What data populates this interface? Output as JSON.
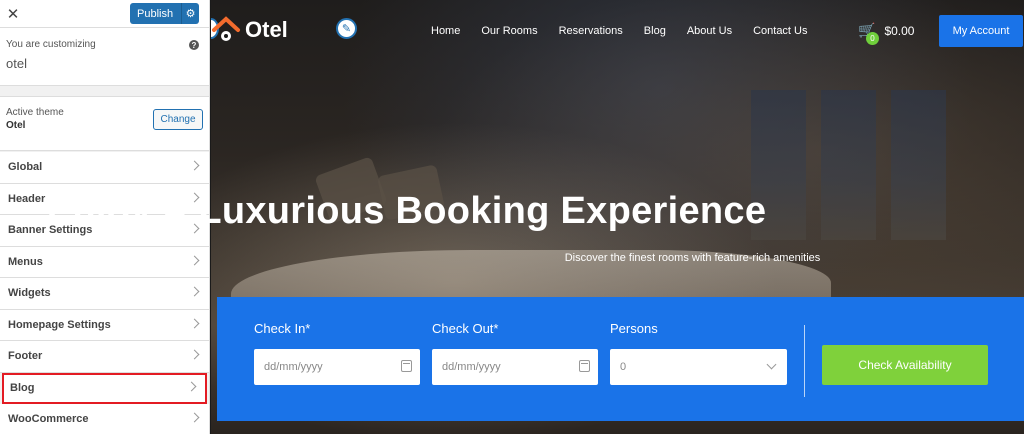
{
  "sidebar": {
    "publish_label": "Publish",
    "customizing_label": "You are customizing",
    "site_name": "otel",
    "active_theme_label": "Active theme",
    "theme_name": "Otel",
    "change_label": "Change",
    "menu": [
      {
        "label": "Global"
      },
      {
        "label": "Header"
      },
      {
        "label": "Banner Settings"
      },
      {
        "label": "Menus"
      },
      {
        "label": "Widgets"
      },
      {
        "label": "Homepage Settings"
      },
      {
        "label": "Footer"
      },
      {
        "label": "Blog"
      },
      {
        "label": "WooCommerce"
      }
    ],
    "highlighted_item": "Blog",
    "highlight_color": "#e31b23",
    "accent_color": "#2271b1"
  },
  "site": {
    "logo_text": "Otel",
    "nav": [
      "Home",
      "Our Rooms",
      "Reservations",
      "Blog",
      "About Us",
      "Contact Us"
    ],
    "cart_count": "0",
    "cart_total": "$0.00",
    "account_label": "My Account",
    "accent_color": "#1a73e8"
  },
  "hero": {
    "title": "Enjoy A Luxurious Booking Experience",
    "subtitle": "Discover the finest rooms with feature-rich amenities"
  },
  "booking": {
    "check_in_label": "Check In*",
    "check_in_placeholder": "dd/mm/yyyy",
    "check_out_label": "Check Out*",
    "check_out_placeholder": "dd/mm/yyyy",
    "persons_label": "Persons",
    "persons_value": "0",
    "button_label": "Check Availability",
    "button_color": "#7fd13b"
  }
}
